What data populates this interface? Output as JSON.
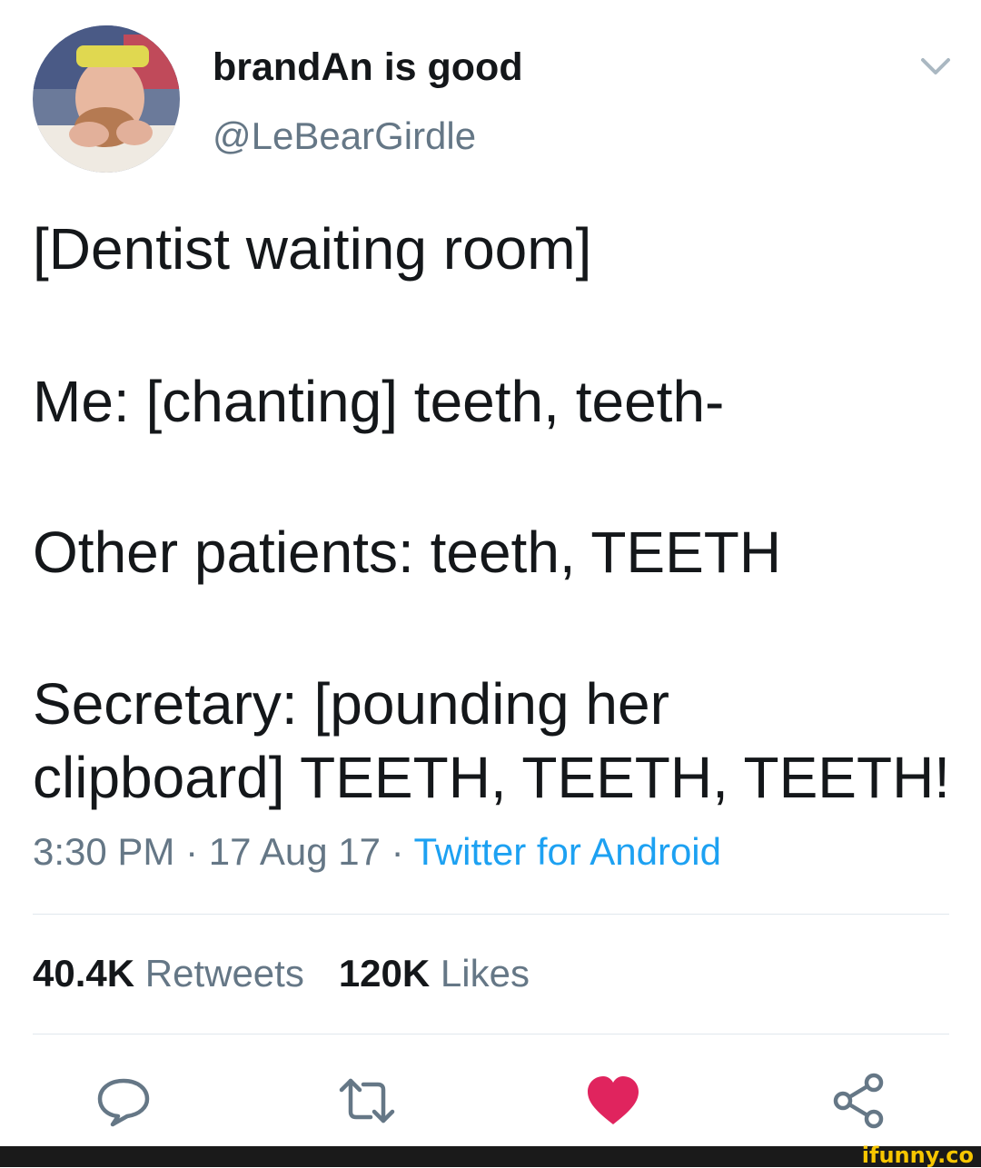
{
  "user": {
    "display_name": "brandAn is good",
    "handle": "@LeBearGirdle",
    "avatar_icon": "profile-photo"
  },
  "tweet": {
    "lines": [
      "[Dentist waiting room]",
      "Me: [chanting] teeth, teeth-",
      "Other patients: teeth, TEETH",
      "Secretary: [pounding her",
      "clipboard] TEETH, TEETH, TEETH!"
    ]
  },
  "meta": {
    "time": "3:30 PM",
    "separator": " · ",
    "date": "17 Aug 17",
    "source": "Twitter for Android"
  },
  "stats": {
    "retweets_count": "40.4K",
    "retweets_label": "Retweets",
    "likes_count": "120K",
    "likes_label": "Likes"
  },
  "actions": {
    "reply_icon": "reply-icon",
    "retweet_icon": "retweet-icon",
    "like_icon": "heart-icon",
    "share_icon": "share-icon"
  },
  "colors": {
    "accent": "#1da1f2",
    "like": "#e0245e",
    "muted": "#657786",
    "text": "#14171a"
  },
  "watermark": "ifunny.co"
}
